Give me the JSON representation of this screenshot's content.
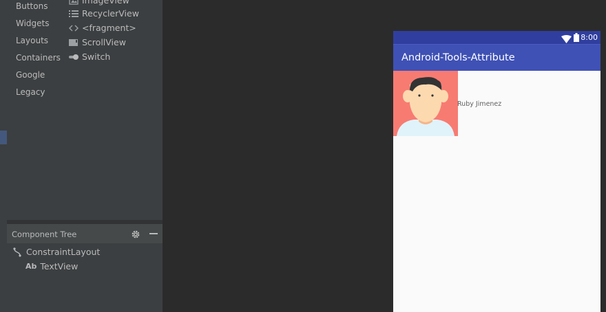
{
  "palette": {
    "categories": [
      "Buttons",
      "Widgets",
      "Layouts",
      "Containers",
      "Google",
      "Legacy"
    ],
    "widgets": [
      {
        "label": "ImageView",
        "icon": "image-icon"
      },
      {
        "label": "RecyclerView",
        "icon": "list-icon"
      },
      {
        "label": "<fragment>",
        "icon": "code-brackets-icon"
      },
      {
        "label": "ScrollView",
        "icon": "scrollview-icon"
      },
      {
        "label": "Switch",
        "icon": "switch-icon"
      }
    ]
  },
  "component_tree": {
    "title": "Component Tree",
    "nodes": [
      {
        "label": "ConstraintLayout",
        "icon": "constraint-layout-icon"
      },
      {
        "label": "TextView",
        "icon_text": "Ab",
        "icon": "textview-icon"
      }
    ]
  },
  "device": {
    "status_time": "8:00",
    "app_title": "Android-Tools-Attribute",
    "user_name": "Ruby Jimenez",
    "colors": {
      "status_bar": "#303f9f",
      "app_bar": "#3f51b5",
      "avatar_bg": "#f87b72",
      "background": "#fafafa"
    }
  }
}
